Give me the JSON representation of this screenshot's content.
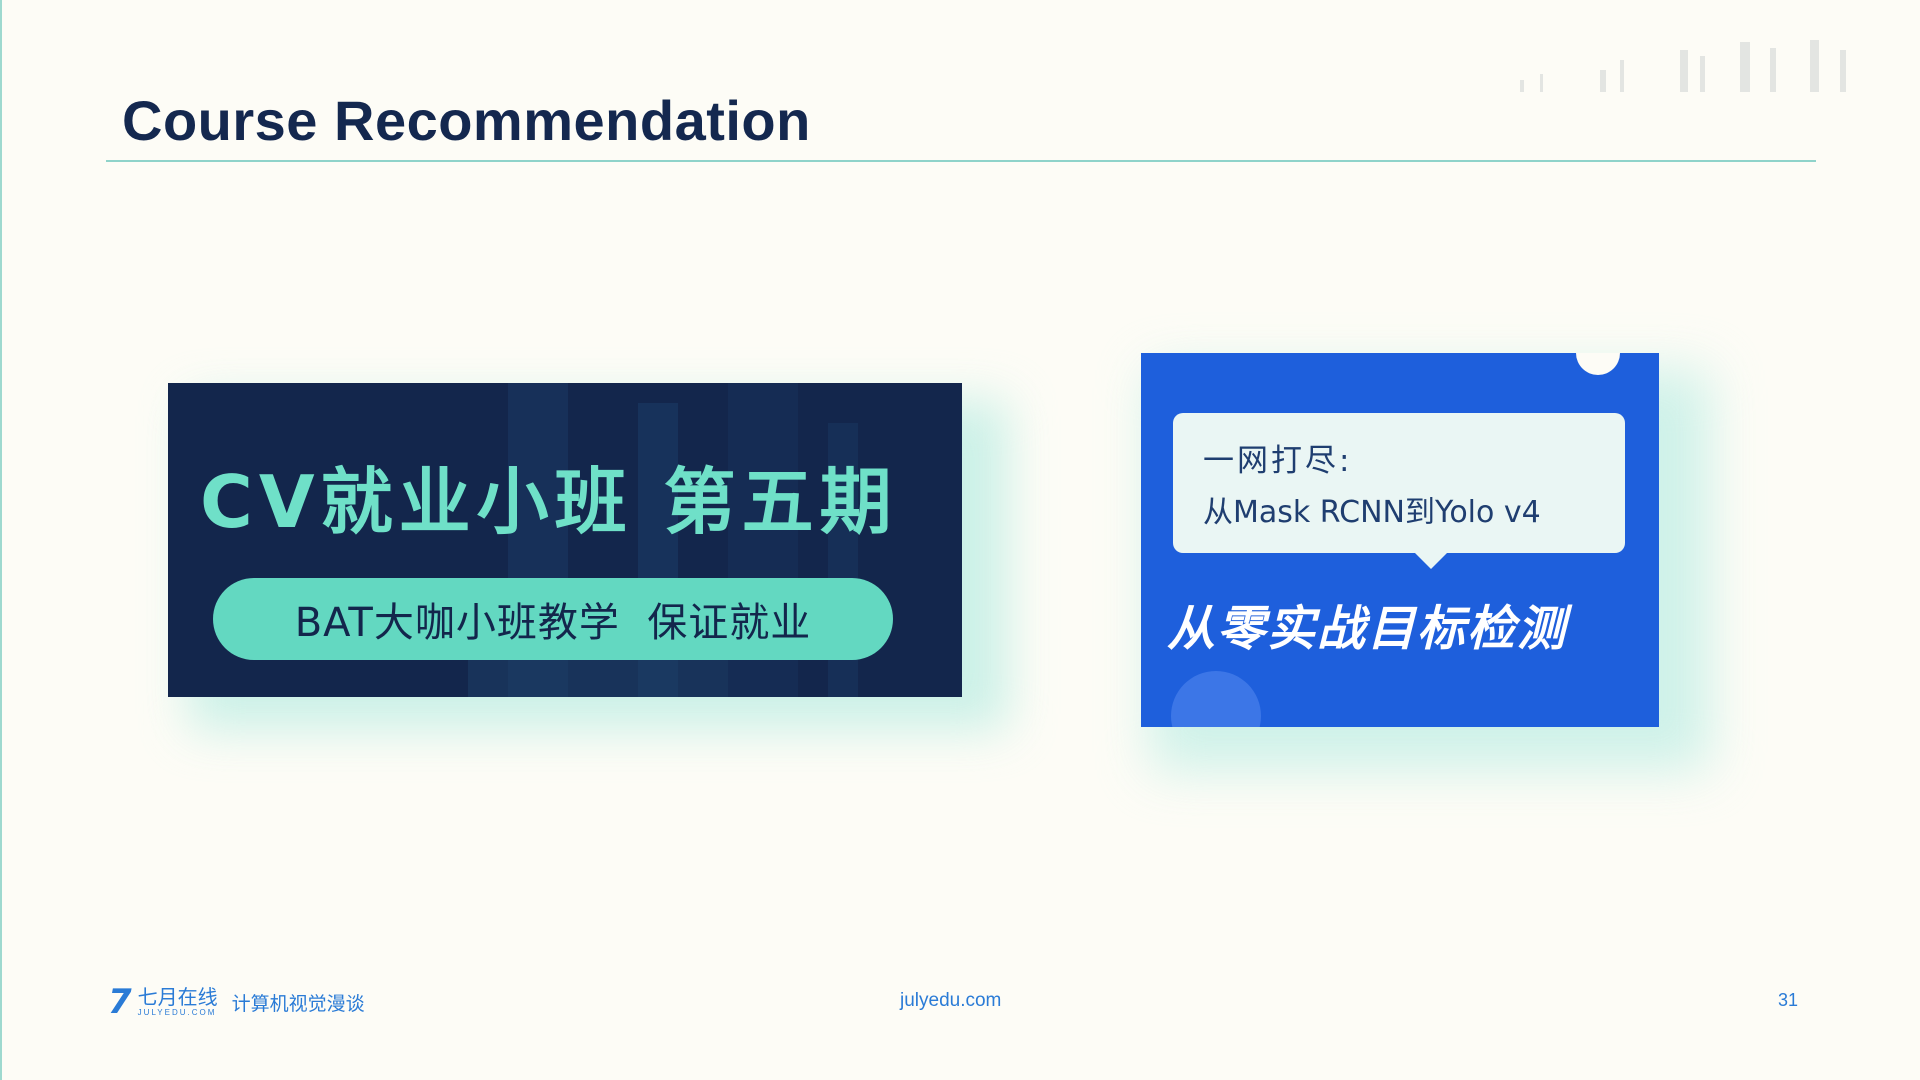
{
  "slide": {
    "title": "Course Recommendation",
    "page_number": "31"
  },
  "cards": {
    "cv_class": {
      "title": "CV就业小班 第五期",
      "pill": "BAT大咖小班教学  保证就业"
    },
    "detection": {
      "bubble_line1": "一网打尽:",
      "bubble_line2": "从Mask RCNN到Yolo v4",
      "title": "从零实战目标检测"
    }
  },
  "footer": {
    "logo_cn": "七月在线",
    "logo_en": "JULYEDU.COM",
    "subtitle": "计算机视觉漫谈",
    "url": "julyedu.com"
  },
  "colors": {
    "background": "#fdfcf6",
    "title": "#14284f",
    "accent_teal": "#63d8c1",
    "navy": "#13264c",
    "blue": "#1e5fdc",
    "footer_blue": "#2a7bd6"
  }
}
